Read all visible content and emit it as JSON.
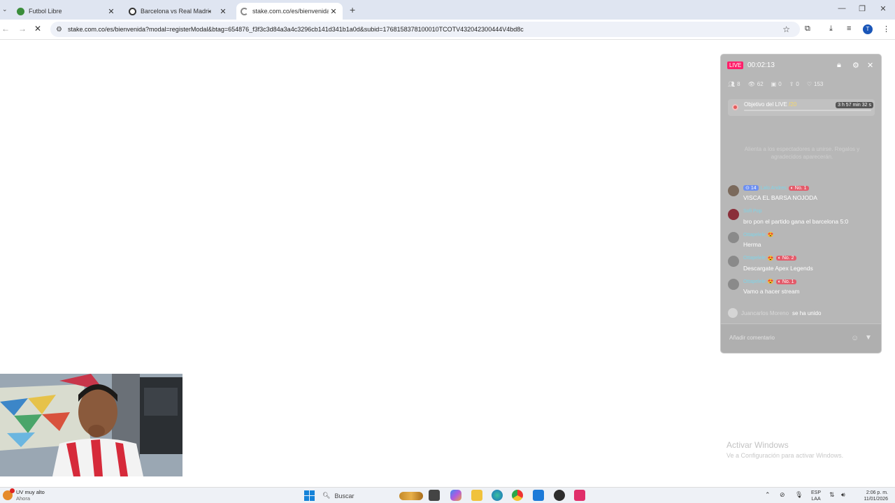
{
  "browser": {
    "tabs": [
      {
        "title": "Futbol Libre",
        "icon": "chrome-icon"
      },
      {
        "title": "Barcelona vs Real Madrid E",
        "icon": "soccer-ball-icon"
      },
      {
        "title": "stake.com.co/es/bienvenida?m",
        "icon": "loading-icon"
      }
    ],
    "new_tab": "+",
    "url": "stake.com.co/es/bienvenida?modal=registerModal&btag=654876_f3f3c3d84a3a4c3296cb141d341b1a0d&subid=1768158378100010TCOTV432042300444V4bd8c",
    "profile_initial": "T"
  },
  "live_panel": {
    "badge": "LIVE",
    "timer": "00:02:13",
    "stats": {
      "users": "8",
      "views": "62",
      "gifts": "0",
      "shares": "0",
      "likes": "153"
    },
    "goal": {
      "label": "Objetivo del LIVE",
      "progress": "/20",
      "time_left": "3 h 57 min 32 s"
    },
    "notice": "Alienta a los espectadores a unirse. Regalos y agradecidos aparecerán.",
    "messages": [
      {
        "badge_level": "14",
        "username": "Lalo Andres",
        "rank": "No. 1",
        "text": "VISCA EL BARSA NOJODA"
      },
      {
        "badge_level": "",
        "username": "Sofi Pop",
        "rank": "",
        "text": "bro pon el partido gana el barcelona 5:0"
      },
      {
        "badge_level": "",
        "username": "Ottapelele",
        "rank": "",
        "text": "Herma"
      },
      {
        "badge_level": "",
        "username": "Ottapelele",
        "rank": "No. 2",
        "text": "Descargate Apex Legends"
      },
      {
        "badge_level": "",
        "username": "Ottapelele",
        "rank": "No. 1",
        "text": "Vamo a hacer stream"
      }
    ],
    "joined": {
      "username": "Juancarlos Moreno",
      "text": "se ha unido"
    },
    "comment_placeholder": "Añadir comentario"
  },
  "activate_windows": {
    "title": "Activar Windows",
    "subtitle": "Ve a Configuración para activar Windows."
  },
  "taskbar": {
    "weather_title": "UV muy alto",
    "weather_sub": "Ahora",
    "weather_alert": "1",
    "search_label": "Buscar",
    "lang_top": "ESP",
    "lang_bottom": "LAA",
    "time": "2:06 p. m.",
    "date": "11/01/2026"
  },
  "colors": {
    "live_red": "#ff1f6a",
    "panel_gray": "#b7b7b7",
    "username_cyan": "#7fd4e8",
    "windows_blue": "#1683d8"
  }
}
